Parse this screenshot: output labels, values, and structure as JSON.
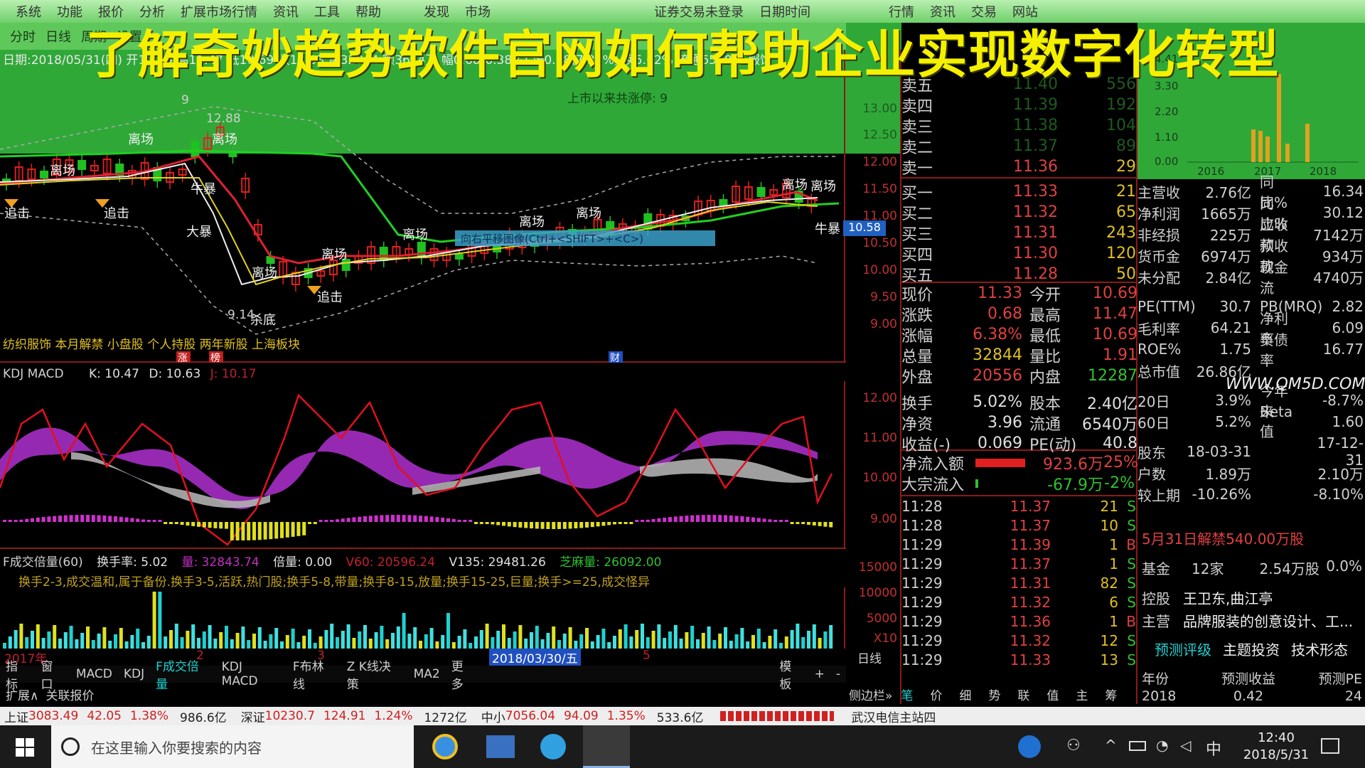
{
  "menu": [
    "系统",
    "功能",
    "报价",
    "分析",
    "扩展市场行情",
    "资讯",
    "工具",
    "帮助"
  ],
  "menu_right": [
    "发现",
    "市场",
    "证券交易未登录",
    "日期时间",
    "行情",
    "资讯",
    "交易",
    "网站"
  ],
  "tabs": [
    "分时",
    "日线",
    "周期",
    "设置"
  ],
  "overlay_title": "了解奇妙趋势软件官网如何帮助企业实现数字化转型",
  "info_line1": "日期:2018/05/31(四) 开10.69 高11.47 低10.69 收11.33 量32844 额3644万 幅0.68(6.38%) 振0.78(7.32%) 换5.02% 流通6540万 服饰",
  "info_line2": "上市以来共涨停: 9",
  "main_axis": [
    "13.00",
    "12.50",
    "12.00",
    "11.50",
    "11.00",
    "10.50",
    "10.00",
    "9.50",
    "9.00"
  ],
  "price_tag": "10.58",
  "chart_labels": {
    "lichang": "离场",
    "jiji": "追击",
    "niubao": "牛暴",
    "dabao": "大暴",
    "shadi": "杀底",
    "peak": "12.88",
    "low": "9.14",
    "nine": "9",
    "cai": "财",
    "zhang": "涨",
    "bang": "榜"
  },
  "tooltip": "向右平移图像(Ctrl+<SHIFT>+<C>)",
  "tags_line": "纺织服饰 本月解禁 小盘股 个人持股 两年新股 上海板块",
  "kdj_header": {
    "name": "KDJ MACD",
    "k": "K: 10.47",
    "d": "D: 10.63",
    "j": "J: 10.17"
  },
  "kdj_axis": [
    "12.00",
    "11.00",
    "10.00",
    "9.00"
  ],
  "vol_header": {
    "name": "F成交倍量(60)",
    "hs": "换手率: 5.02",
    "liang": "量: 32843.74",
    "bl": "倍量: 0.00",
    "v60": "V60: 20596.24",
    "v135": "V135: 29481.26",
    "zhl": "芝麻量: 26092.00"
  },
  "vol_note": "换手2-3,成交温和,属于备份.换手3-5,活跃,热门股;换手5-8,带量;换手8-15,放量;换手15-25,巨量;换手>=25,成交怪异",
  "vol_axis": [
    "15000",
    "10000",
    "5000",
    "X10"
  ],
  "date_bar": {
    "year": "2017年",
    "m2": "2",
    "m3": "3",
    "sel": "2018/03/30/五",
    "m5": "5",
    "right": "日线"
  },
  "bottom_tabs": [
    "指标",
    "窗口",
    "MACD",
    "KDJ",
    "F成交倍量",
    "KDJ MACD",
    "F布林线",
    "Z K线决策",
    "MA2",
    "更多"
  ],
  "bottom_tabs_right": [
    "模板",
    "+",
    "-"
  ],
  "bottom_row2": [
    "扩展∧",
    "关联报价"
  ],
  "right_lower_tabs": [
    "侧边栏»",
    "笔",
    "价",
    "细",
    "势",
    "联",
    "值",
    "主",
    "筹"
  ],
  "sell_ticks": [
    {
      "label": "卖五",
      "price": "11.40",
      "vol": "556"
    },
    {
      "label": "卖四",
      "price": "11.39",
      "vol": "192"
    },
    {
      "label": "卖三",
      "price": "11.38",
      "vol": "104"
    },
    {
      "label": "卖二",
      "price": "11.37",
      "vol": "89"
    },
    {
      "label": "卖一",
      "price": "11.36",
      "vol": "29"
    }
  ],
  "buy_ticks": [
    {
      "label": "买一",
      "price": "11.33",
      "vol": "21"
    },
    {
      "label": "买二",
      "price": "11.32",
      "vol": "65"
    },
    {
      "label": "买三",
      "price": "11.31",
      "vol": "243"
    },
    {
      "label": "买四",
      "price": "11.30",
      "vol": "120"
    },
    {
      "label": "买五",
      "price": "11.28",
      "vol": "50"
    }
  ],
  "quote_stats": [
    {
      "k": "现价",
      "v": "11.33",
      "k2": "今开",
      "v2": "10.69"
    },
    {
      "k": "涨跌",
      "v": "0.68",
      "k2": "最高",
      "v2": "11.47"
    },
    {
      "k": "涨幅",
      "v": "6.38%",
      "k2": "最低",
      "v2": "10.69"
    },
    {
      "k": "总量",
      "v": "32844",
      "k2": "量比",
      "v2": "1.91"
    },
    {
      "k": "外盘",
      "v": "20556",
      "k2": "内盘",
      "v2": "12287"
    },
    {
      "k": "换手",
      "v": "5.02%",
      "k2": "股本",
      "v2": "2.40亿"
    },
    {
      "k": "净资",
      "v": "3.96",
      "k2": "流通",
      "v2": "6540万"
    },
    {
      "k": "收益(-)",
      "v": "0.069",
      "k2": "PE(动)",
      "v2": "40.8"
    }
  ],
  "flows": [
    {
      "k": "净流入额",
      "v": "923.6万",
      "p": "25%"
    },
    {
      "k": "大宗流入",
      "v": "-67.9万",
      "p": "-2%"
    }
  ],
  "trades": [
    {
      "t": "11:28",
      "p": "11.37",
      "v": "21",
      "s": "S"
    },
    {
      "t": "11:28",
      "p": "11.37",
      "v": "10",
      "s": "S"
    },
    {
      "t": "11:29",
      "p": "11.39",
      "v": "1",
      "s": "B"
    },
    {
      "t": "11:29",
      "p": "11.37",
      "v": "1",
      "s": "S"
    },
    {
      "t": "11:29",
      "p": "11.31",
      "v": "82",
      "s": "S"
    },
    {
      "t": "11:29",
      "p": "11.32",
      "v": "6",
      "s": "S"
    },
    {
      "t": "11:29",
      "p": "11.36",
      "v": "1",
      "s": "B"
    },
    {
      "t": "11:29",
      "p": "11.32",
      "v": "12",
      "s": "S"
    },
    {
      "t": "11:29",
      "p": "11.33",
      "v": "13",
      "s": "S"
    }
  ],
  "mini_chart": {
    "y": [
      "4.41",
      "3.30",
      "2.20",
      "1.10",
      "0.00"
    ],
    "x": [
      "2016",
      "2017",
      "2018"
    ]
  },
  "fin_rows": [
    {
      "a": "主营收",
      "b": "2.76亿",
      "c": "同比%",
      "d": "16.34"
    },
    {
      "a": "净利润",
      "b": "1665万",
      "c": "同比%",
      "d": "30.12"
    },
    {
      "a": "非经损",
      "b": "225万",
      "c": "应收款",
      "d": "7142万"
    },
    {
      "a": "货币金",
      "b": "6974万",
      "c": "预收款",
      "d": "934万"
    },
    {
      "a": "未分配",
      "b": "2.84亿",
      "c": "现金流",
      "d": "4740万"
    },
    {
      "a": "PE(TTM)",
      "b": "30.7",
      "c": "PB(MRQ)",
      "d": "2.82"
    },
    {
      "a": "毛利率",
      "b": "64.21",
      "c": "净利率",
      "d": "6.09"
    },
    {
      "a": "ROE%",
      "b": "1.75",
      "c": "负债率",
      "d": "16.77"
    },
    {
      "a": "总市值",
      "b": "26.86亿",
      "c": "",
      "d": ""
    },
    {
      "a": "20日",
      "b": "3.9%",
      "c": "今年来",
      "d": "-8.7%"
    },
    {
      "a": "60日",
      "b": "5.2%",
      "c": "Beta值",
      "d": "1.60"
    },
    {
      "a": "股东",
      "b": "18-03-31",
      "c": "",
      "d": "17-12-31"
    },
    {
      "a": "户数",
      "b": "1.89万",
      "c": "",
      "d": "2.10万"
    },
    {
      "a": "较上期",
      "b": "-10.26%",
      "c": "",
      "d": "-8.10%"
    }
  ],
  "watermark": "WWW.QM5D.COM",
  "unlock_note": "5月31日解禁540.00万股",
  "fund_row": {
    "k": "基金",
    "n": "12家",
    "v": "2.54万股",
    "p": "0.0%"
  },
  "holder_row": {
    "k": "控股",
    "v": "王卫东,曲江亭"
  },
  "main_biz": {
    "k": "主营",
    "v": "品牌服装的创意设计、工..."
  },
  "forecast_tabs": [
    "预测评级",
    "主题投资",
    "技术形态"
  ],
  "forecast_head": [
    "年份",
    "预测收益",
    "预测PE"
  ],
  "forecast_row": {
    "y": "2018",
    "e": "0.42",
    "pe": "24"
  },
  "status_bar": [
    {
      "name": "上证",
      "val": "3083.49",
      "chg": "42.05",
      "pct": "1.38%",
      "amt": "986.6亿"
    },
    {
      "name": "深证",
      "val": "10230.7",
      "chg": "124.91",
      "pct": "1.24%",
      "amt": "1272亿"
    },
    {
      "name": "中小",
      "val": "7056.04",
      "chg": "94.09",
      "pct": "1.35%",
      "amt": "533.6亿"
    }
  ],
  "server": "武汉电信主站四",
  "taskbar": {
    "search": "在这里输入你要搜索的内容",
    "time": "12:40",
    "date": "2018/5/31",
    "ime": "中"
  },
  "colors": {
    "up": "#e03030",
    "down": "#30c030",
    "yellow": "#e0c020",
    "cyan": "#20d0d0",
    "magenta": "#b030d0"
  }
}
